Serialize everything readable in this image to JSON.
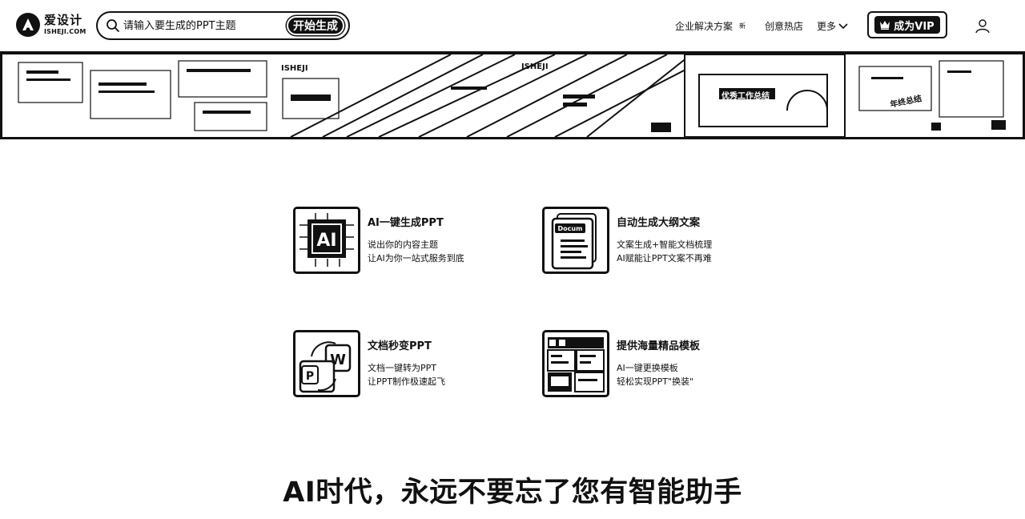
{
  "header": {
    "logo": {
      "cn": "爱设计",
      "en": "ISHEJI.COM"
    },
    "search": {
      "placeholder": "请输入要生成的PPT主题",
      "button": "开始生成"
    },
    "nav": {
      "enterprise": "企业解决方案",
      "enterprise_badge": "新",
      "hot": "创意热店",
      "more": "更多"
    },
    "vip_button": "成为VIP"
  },
  "banner": {
    "tags": [
      "ISHEJI",
      "ISHEJI",
      "优秀工作总结",
      "年终总结"
    ]
  },
  "features": [
    {
      "title": "AI一键生成PPT",
      "lines": [
        "说出你的内容主题",
        "让AI为你一站式服务到底"
      ],
      "icon": "ai-chip-icon"
    },
    {
      "title": "自动生成大纲文案",
      "lines": [
        "文案生成+智能文档梳理",
        "AI赋能让PPT文案不再难"
      ],
      "icon": "document-icon"
    },
    {
      "title": "文档秒变PPT",
      "lines": [
        "文档一键转为PPT",
        "让PPT制作极速起飞"
      ],
      "icon": "word-to-ppt-icon"
    },
    {
      "title": "提供海量精品模板",
      "lines": [
        "AI一键更换模板",
        "轻松实现PPT\"换装\""
      ],
      "icon": "template-icon"
    }
  ],
  "headline": "AI时代，永远不要忘了您有智能助手",
  "colors": {
    "primary": "#111111",
    "background": "#ffffff"
  }
}
